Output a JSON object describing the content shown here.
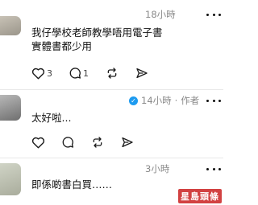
{
  "comments": [
    {
      "avatar_colors": [
        "#c8c2b6",
        "#9a958a"
      ],
      "timestamp": "18小時",
      "lines": [
        "我仔學校老師教學唔用電子書",
        "實體書都少用"
      ],
      "like_count": "3",
      "reply_count": "1"
    },
    {
      "avatar_colors": [
        "#b8b8b8",
        "#6e6e6e"
      ],
      "timestamp": "14小時",
      "author_tag": "作者",
      "verified_badge": "verified-badge",
      "lines": [
        "太好啦..."
      ],
      "like_count": "",
      "reply_count": ""
    },
    {
      "avatar_colors": [
        "#d0d4c6",
        "#a9ac9c"
      ],
      "timestamp": "3小時",
      "lines": [
        "即係啲書白買……"
      ]
    }
  ],
  "separator": "·",
  "icons": {
    "like": "heart-icon",
    "reply": "reply-bubble-icon",
    "repost": "repost-icon",
    "share": "share-send-icon",
    "more": "more-options-icon"
  },
  "watermark": "星島頭條",
  "colors": {
    "meta_text": "#8a8a8a",
    "verified": "#1d9bf0",
    "watermark_bg": "#c81919"
  }
}
